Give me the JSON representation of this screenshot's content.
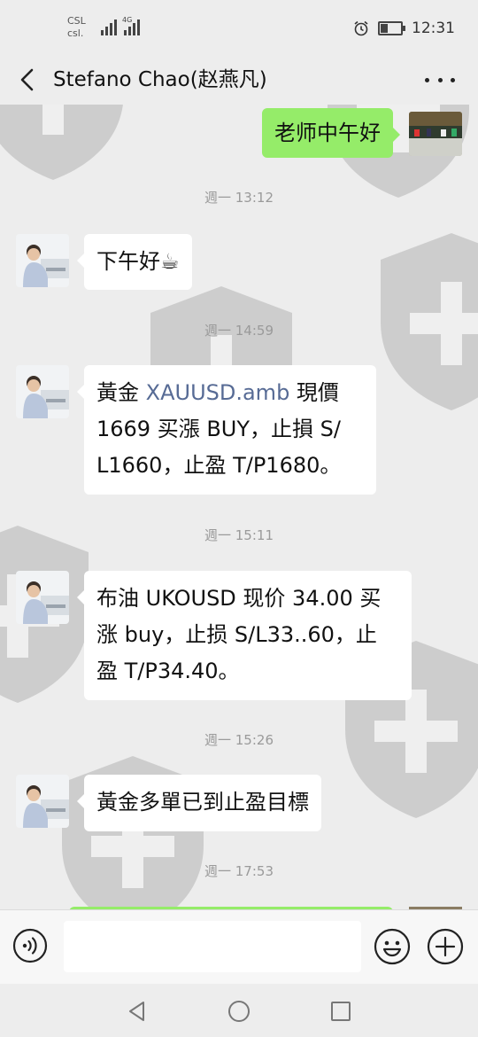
{
  "status_bar": {
    "carrier_1": "CSL",
    "carrier_2": "csl.",
    "network_tag": "4G",
    "time": "12:31",
    "battery_percent": 35
  },
  "header": {
    "back_icon": "chevron-left-icon",
    "title": "Stefano Chao(赵燕凡)",
    "more_icon": "more-dots-icon"
  },
  "messages": [
    {
      "type": "sent",
      "text": "老师中午好"
    },
    {
      "type": "time",
      "text": "週一 13:12"
    },
    {
      "type": "received",
      "text": "下午好☕"
    },
    {
      "type": "time",
      "text": "週一 14:59"
    },
    {
      "type": "received",
      "lines": [
        "黃金 ",
        "XAUUSD.amb",
        " 現價",
        "1669 买漲 BUY，止損 S/",
        "L1660，止盈 T/P1680。"
      ]
    },
    {
      "type": "time",
      "text": "週一 15:11"
    },
    {
      "type": "received",
      "lines": [
        "布油 UKOUSD 现价 34.00 买",
        "涨 buy，止损 S/L33..60，止",
        "盈 T/P34.40。"
      ]
    },
    {
      "type": "time",
      "text": "週一 15:26"
    },
    {
      "type": "received",
      "text": "黃金多單已到止盈目標"
    },
    {
      "type": "time",
      "text": "週一 17:53"
    }
  ],
  "input_bar": {
    "voice_icon": "voice-icon",
    "emoji_icon": "emoji-icon",
    "plus_icon": "plus-icon",
    "text_value": ""
  },
  "system_nav": [
    "back-triangle-icon",
    "home-circle-icon",
    "recents-square-icon"
  ],
  "colors": {
    "background": "#ededed",
    "sent_bubble": "#95ec69",
    "received_bubble": "#ffffff",
    "link": "#576b95",
    "timestamp": "#9a9a9a"
  }
}
